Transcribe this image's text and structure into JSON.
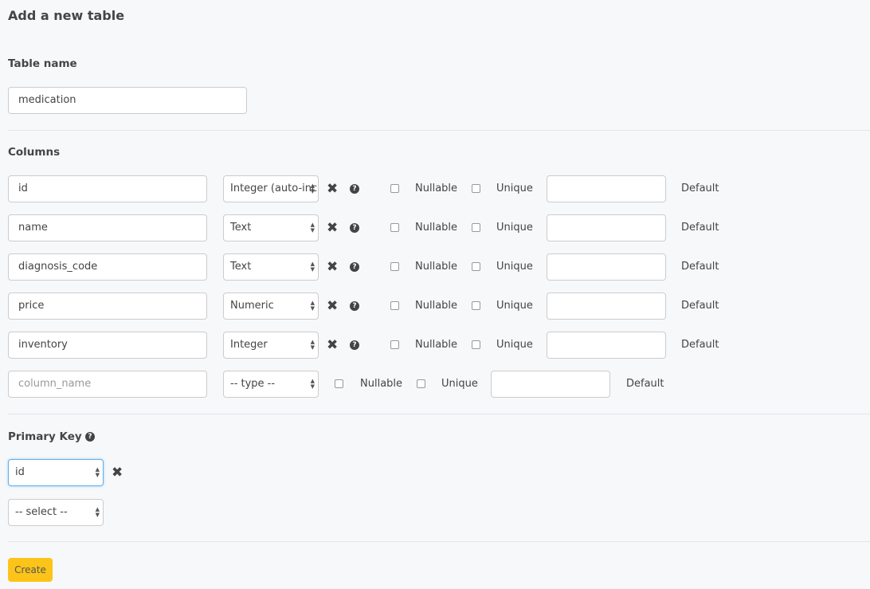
{
  "title": "Add a new table",
  "table_name": {
    "label": "Table name",
    "value": "medication"
  },
  "columns": {
    "label": "Columns",
    "nullable_label": "Nullable",
    "unique_label": "Unique",
    "default_label": "Default",
    "rows": [
      {
        "name": "id",
        "type": "Integer (auto-increment)",
        "nullable": false,
        "unique": false,
        "default": ""
      },
      {
        "name": "name",
        "type": "Text",
        "nullable": false,
        "unique": false,
        "default": ""
      },
      {
        "name": "diagnosis_code",
        "type": "Text",
        "nullable": false,
        "unique": false,
        "default": ""
      },
      {
        "name": "price",
        "type": "Numeric",
        "nullable": false,
        "unique": false,
        "default": ""
      },
      {
        "name": "inventory",
        "type": "Integer",
        "nullable": false,
        "unique": false,
        "default": ""
      }
    ],
    "new_row": {
      "name_placeholder": "column_name",
      "type_placeholder": "-- type --"
    }
  },
  "primary_key": {
    "label": "Primary Key",
    "selected": [
      "id"
    ],
    "select_placeholder": "-- select --"
  },
  "create_label": "Create",
  "colors": {
    "accent": "#fcc419",
    "background": "#f7f8fa"
  }
}
